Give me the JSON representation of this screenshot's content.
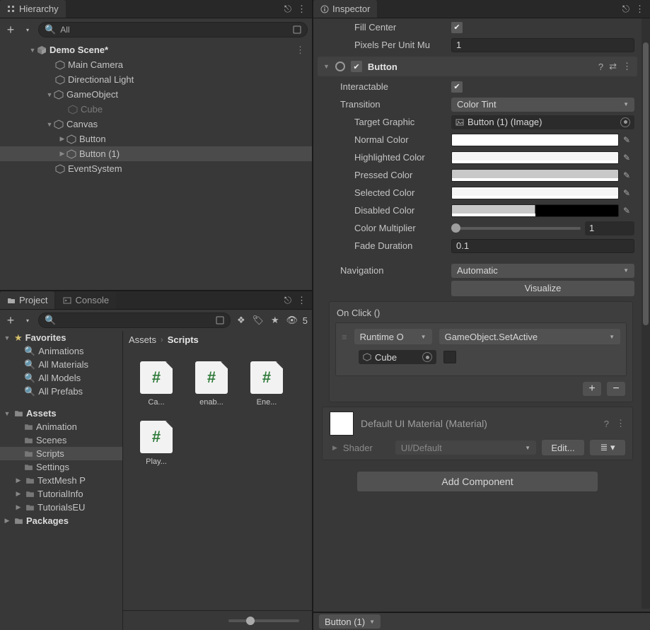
{
  "hierarchy": {
    "tab": "Hierarchy",
    "search": "All",
    "add_btn": "+",
    "scene": "Demo Scene*",
    "items": {
      "main_camera": "Main Camera",
      "dir_light": "Directional Light",
      "gameobject": "GameObject",
      "cube": "Cube",
      "canvas": "Canvas",
      "button": "Button",
      "button1": "Button (1)",
      "eventsystem": "EventSystem"
    }
  },
  "project": {
    "tab_project": "Project",
    "tab_console": "Console",
    "hidden_count": "5",
    "favorites": "Favorites",
    "fav_animations": "Animations",
    "fav_materials": "All Materials",
    "fav_models": "All Models",
    "fav_prefabs": "All Prefabs",
    "assets_header": "Assets",
    "folders": {
      "animation": "Animation",
      "scenes": "Scenes",
      "scripts": "Scripts",
      "settings": "Settings",
      "textmeshp": "TextMesh P",
      "tutorialinfo": "TutorialInfo",
      "tutorialseu": "TutorialsEU",
      "packages": "Packages"
    },
    "breadcrumb_root": "Assets",
    "breadcrumb_current": "Scripts",
    "assets": [
      "Ca...",
      "enab...",
      "Ene...",
      "Play..."
    ]
  },
  "inspector": {
    "tab": "Inspector",
    "fill_center_label": "Fill Center",
    "pixels_label": "Pixels Per Unit Mu",
    "pixels_value": "1",
    "component_name": "Button",
    "interactable_label": "Interactable",
    "transition_label": "Transition",
    "transition_value": "Color Tint",
    "target_graphic_label": "Target Graphic",
    "target_graphic_value": "Button (1) (Image)",
    "normal_color_label": "Normal Color",
    "highlighted_color_label": "Highlighted Color",
    "pressed_color_label": "Pressed Color",
    "selected_color_label": "Selected Color",
    "disabled_color_label": "Disabled Color",
    "color_multiplier_label": "Color Multiplier",
    "color_multiplier_value": "1",
    "fade_duration_label": "Fade Duration",
    "fade_duration_value": "0.1",
    "navigation_label": "Navigation",
    "navigation_value": "Automatic",
    "visualize_btn": "Visualize",
    "onclick_header": "On Click ()",
    "onclick_runtime": "Runtime O",
    "onclick_target_method": "GameObject.SetActive",
    "onclick_obj": "Cube",
    "material_title": "Default UI Material (Material)",
    "shader_label": "Shader",
    "shader_value": "UI/Default",
    "edit_btn": "Edit...",
    "add_component": "Add Component",
    "bottom_selector": "Button (1)"
  },
  "colors": {
    "normal": "#ffffff",
    "highlighted": "#f5f5f5",
    "pressed": "#c8c8c8",
    "selected": "#f5f5f5",
    "disabled_left": "#c8c8c8",
    "disabled_right": "#000000"
  }
}
